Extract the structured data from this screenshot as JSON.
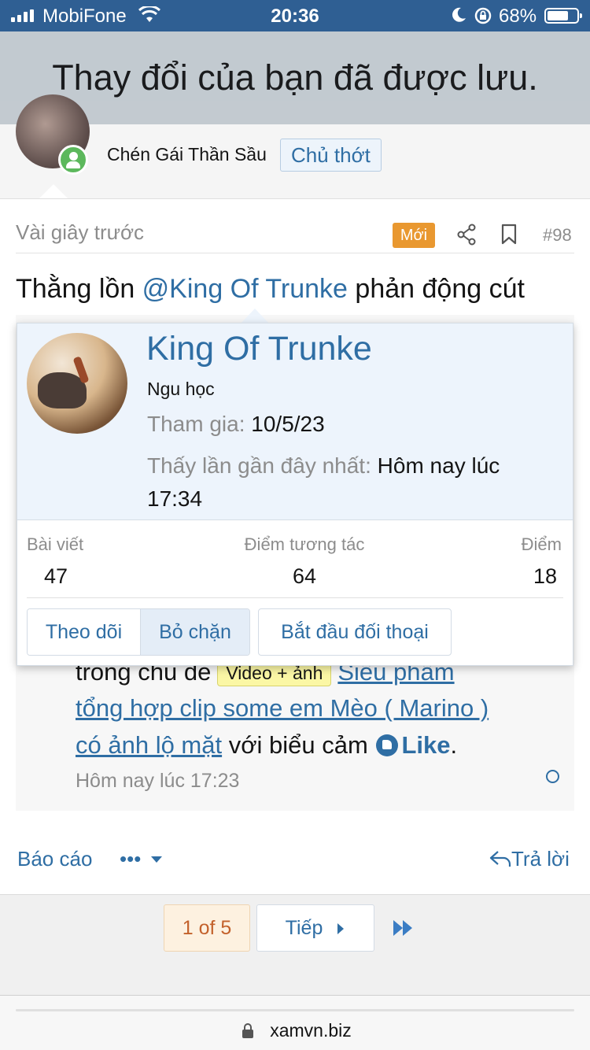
{
  "status_bar": {
    "carrier": "MobiFone",
    "time": "20:36",
    "battery_pct": "68%"
  },
  "toast": {
    "message": "Thay đổi của bạn đã được lưu."
  },
  "post": {
    "author_name": "Chén Gái Thần Sầu",
    "author_role": "Chủ thớt",
    "time": "Vài giây trước",
    "new_badge": "Mới",
    "number": "#98",
    "text_prefix": "Thằng lồn ",
    "mention": "@King Of Trunke",
    "text_suffix": " phản động cút",
    "quote": {
      "line1_prefix": "trong chủ đề",
      "tag": "Video + ảnh",
      "link_part1": "Siêu phẩm",
      "link_part2": "tổng hợp clip some em Mèo ( Marino )",
      "link_part3": "có ảnh lộ mặt",
      "line3_suffix": " với biểu cảm ",
      "like_label": "Like",
      "period": ".",
      "time": "Hôm nay lúc 17:23"
    },
    "actions": {
      "report": "Báo cáo",
      "more": "•••",
      "reply": "Trả lời"
    }
  },
  "member_card": {
    "name": "King Of Trunke",
    "title": "Ngu học",
    "joined_label": "Tham gia:",
    "joined_value": "10/5/23",
    "last_seen_label": "Thấy lần gần đây nhất:",
    "last_seen_value": "Hôm nay lúc 17:34",
    "stats": {
      "posts_label": "Bài viết",
      "posts_value": "47",
      "reactions_label": "Điểm tương tác",
      "reactions_value": "64",
      "points_label": "Điểm",
      "points_value": "18"
    },
    "buttons": {
      "follow": "Theo dõi",
      "unblock": "Bỏ chặn",
      "start_conversation": "Bắt đầu đối thoại"
    }
  },
  "pagination": {
    "current": "1 of 5",
    "next": "Tiếp"
  },
  "browser": {
    "url": "xamvn.biz"
  }
}
